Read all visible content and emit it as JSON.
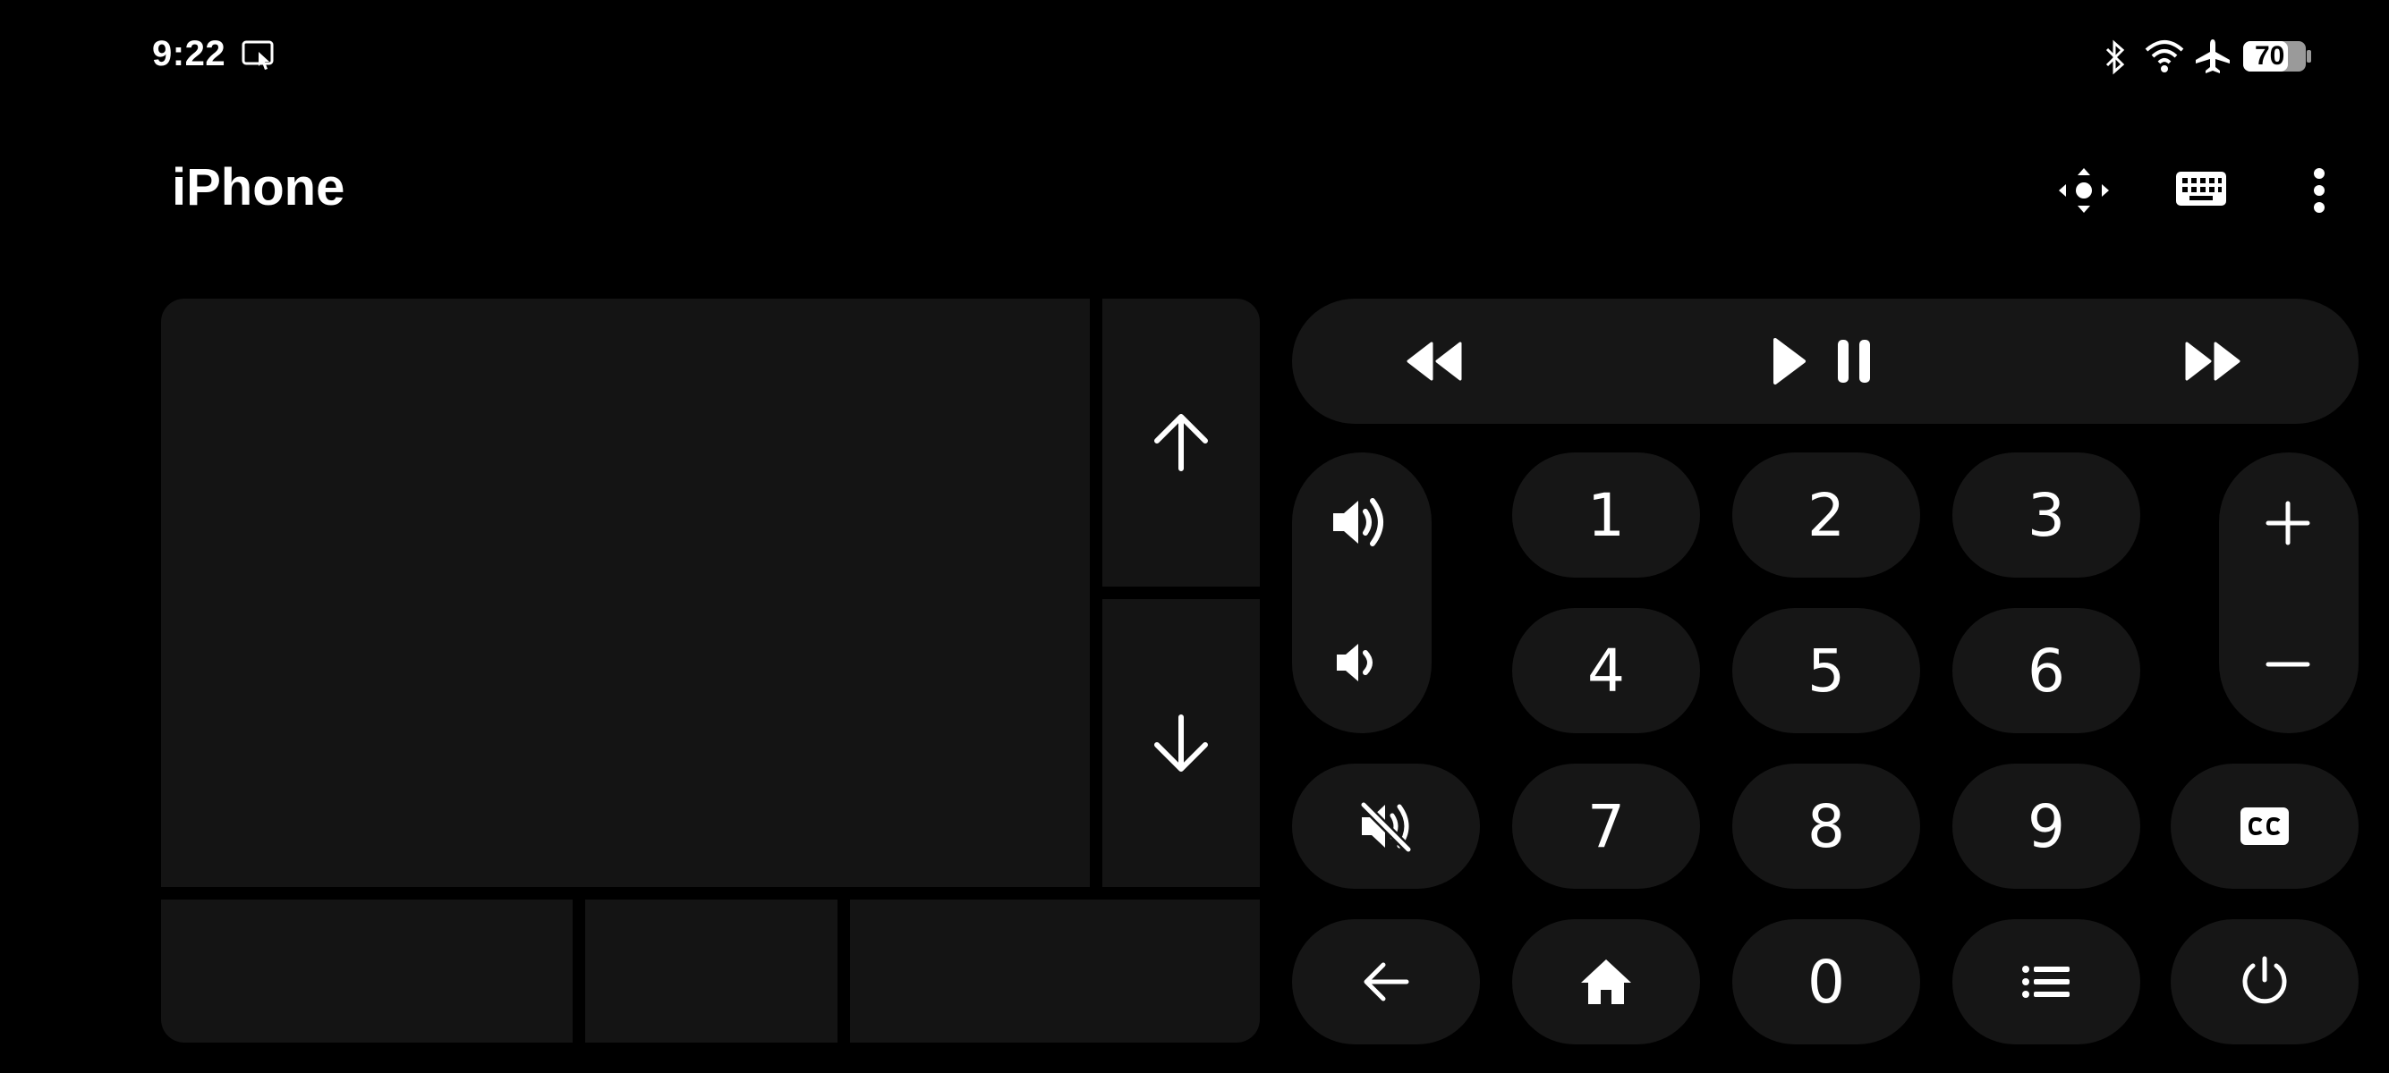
{
  "status_bar": {
    "time": "9:22",
    "battery": "70",
    "icons": [
      "screen-cast-icon",
      "bluetooth-icon",
      "wifi-icon",
      "airplane-icon",
      "battery-icon"
    ]
  },
  "app_bar": {
    "title": "iPhone",
    "actions": [
      "dpad-icon",
      "keyboard-icon",
      "more-vert-icon"
    ]
  },
  "touchpad": {
    "scroll_up": "arrow-up-icon",
    "scroll_down": "arrow-down-icon",
    "bottom_buttons": [
      "left-click",
      "middle-click",
      "right-click"
    ]
  },
  "media": {
    "controls": [
      "rewind-icon",
      "play-pause-icon",
      "fast-forward-icon"
    ]
  },
  "keypad": {
    "digits": [
      "1",
      "2",
      "3",
      "4",
      "5",
      "6",
      "7",
      "8",
      "9",
      "0"
    ]
  },
  "volume": {
    "controls": [
      "volume-up-icon",
      "volume-down-icon",
      "mute-icon"
    ]
  },
  "channel": {
    "controls": [
      "plus-icon",
      "minus-icon"
    ]
  },
  "bottom_row": {
    "controls": [
      "back-icon",
      "home-icon",
      "menu-list-icon",
      "power-icon",
      "closed-captions-icon"
    ]
  },
  "colors": {
    "background": "#000000",
    "panel": "#141414",
    "button": "#161616",
    "foreground": "#ffffff"
  }
}
